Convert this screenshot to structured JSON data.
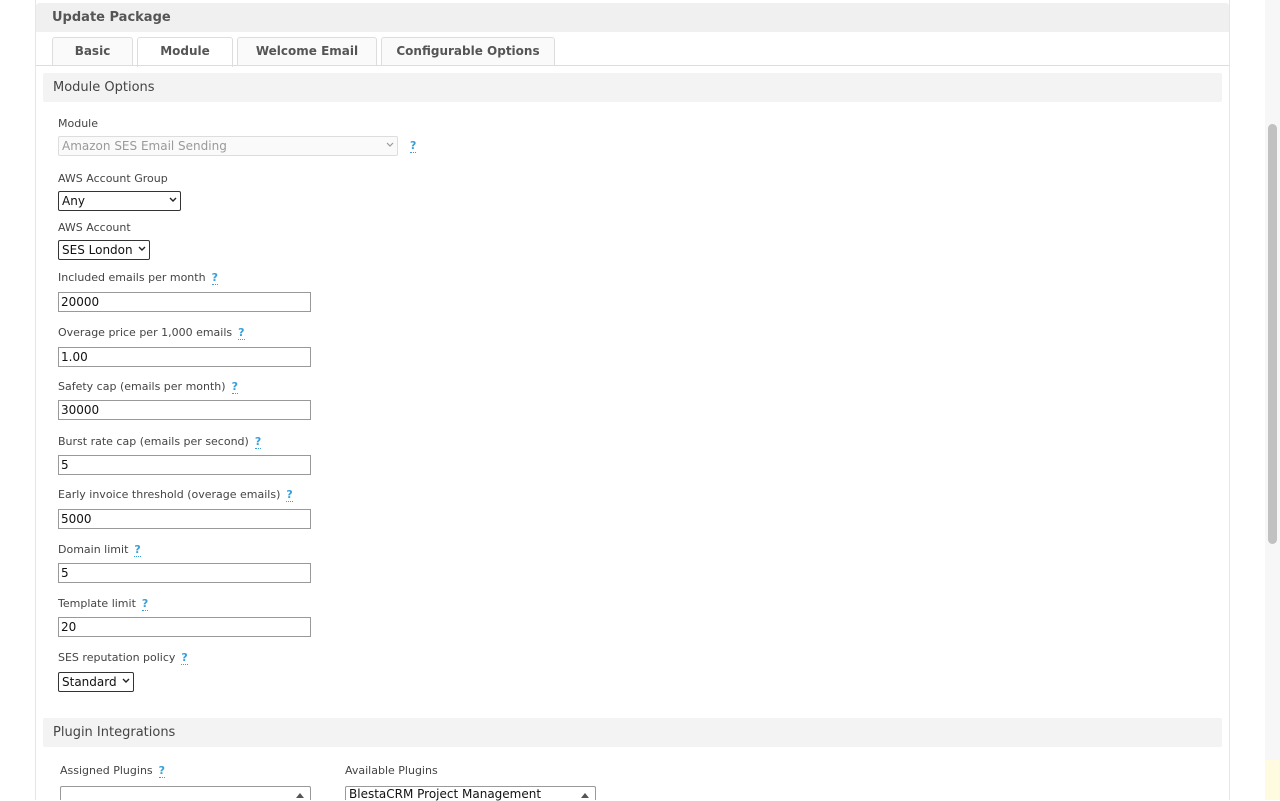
{
  "page": {
    "title": "Update Package"
  },
  "tabs": [
    {
      "label": "Basic"
    },
    {
      "label": "Module"
    },
    {
      "label": "Welcome Email"
    },
    {
      "label": "Configurable Options"
    }
  ],
  "module_options": {
    "header": "Module Options",
    "module": {
      "label": "Module",
      "value": "Amazon SES Email Sending",
      "help": "?"
    },
    "aws_account_group": {
      "label": "AWS Account Group",
      "value": "Any"
    },
    "aws_account": {
      "label": "AWS Account",
      "value": "SES London"
    },
    "included_emails": {
      "label": "Included emails per month",
      "help": "?",
      "value": "20000"
    },
    "overage_price": {
      "label": "Overage price per 1,000 emails",
      "help": "?",
      "value": "1.00"
    },
    "safety_cap": {
      "label": "Safety cap (emails per month)",
      "help": "?",
      "value": "30000"
    },
    "burst_rate": {
      "label": "Burst rate cap (emails per second)",
      "help": "?",
      "value": "5"
    },
    "early_invoice": {
      "label": "Early invoice threshold (overage emails)",
      "help": "?",
      "value": "5000"
    },
    "domain_limit": {
      "label": "Domain limit",
      "help": "?",
      "value": "5"
    },
    "template_limit": {
      "label": "Template limit",
      "help": "?",
      "value": "20"
    },
    "reputation_policy": {
      "label": "SES reputation policy",
      "help": "?",
      "value": "Standard"
    }
  },
  "plugin_integrations": {
    "header": "Plugin Integrations",
    "assigned": {
      "label": "Assigned Plugins",
      "help": "?",
      "items": []
    },
    "available": {
      "label": "Available Plugins",
      "first_item": "BlestaCRM Project Management"
    }
  },
  "colors": {
    "help_link": "#3a9fd8",
    "section_bg": "#f3f3f3"
  }
}
